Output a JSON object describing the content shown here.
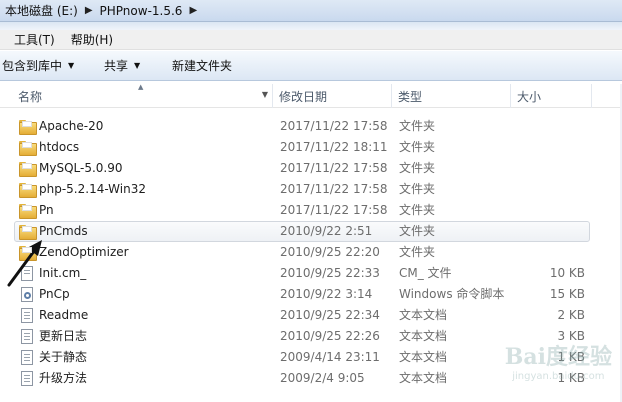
{
  "address_bar": {
    "crumbs": [
      "本地磁盘 (E:)",
      "PHPnow-1.5.6"
    ],
    "separator": "▶"
  },
  "menu": {
    "items": [
      "工具(T)",
      "帮助(H)"
    ]
  },
  "toolbar": {
    "include_library_label": "包含到库中",
    "share_label": "共享",
    "new_folder_label": "新建文件夹"
  },
  "columns": {
    "name": "名称",
    "date": "修改日期",
    "type": "类型",
    "size": "大小"
  },
  "files": [
    {
      "name": "Apache-20",
      "date": "2017/11/22 17:58",
      "type": "文件夹",
      "size": "",
      "icon": "folder-icon"
    },
    {
      "name": "htdocs",
      "date": "2017/11/22 18:11",
      "type": "文件夹",
      "size": "",
      "icon": "folder-icon"
    },
    {
      "name": "MySQL-5.0.90",
      "date": "2017/11/22 17:58",
      "type": "文件夹",
      "size": "",
      "icon": "folder-icon"
    },
    {
      "name": "php-5.2.14-Win32",
      "date": "2017/11/22 17:58",
      "type": "文件夹",
      "size": "",
      "icon": "folder-icon"
    },
    {
      "name": "Pn",
      "date": "2017/11/22 17:58",
      "type": "文件夹",
      "size": "",
      "icon": "folder-icon"
    },
    {
      "name": "PnCmds",
      "date": "2010/9/22 2:51",
      "type": "文件夹",
      "size": "",
      "icon": "folder-icon",
      "selected": true
    },
    {
      "name": "ZendOptimizer",
      "date": "2010/9/25 22:20",
      "type": "文件夹",
      "size": "",
      "icon": "folder-icon"
    },
    {
      "name": "Init.cm_",
      "date": "2010/9/25 22:33",
      "type": "CM_ 文件",
      "size": "10 KB",
      "icon": "file-icon"
    },
    {
      "name": "PnCp",
      "date": "2010/9/22 3:14",
      "type": "Windows 命令脚本",
      "size": "15 KB",
      "icon": "cmd-script-icon"
    },
    {
      "name": "Readme",
      "date": "2010/9/25 22:34",
      "type": "文本文档",
      "size": "2 KB",
      "icon": "text-document-icon"
    },
    {
      "name": "更新日志",
      "date": "2010/9/25 22:26",
      "type": "文本文档",
      "size": "3 KB",
      "icon": "text-document-icon"
    },
    {
      "name": "关于静态",
      "date": "2009/4/14 23:11",
      "type": "文本文档",
      "size": "1 KB",
      "icon": "text-document-icon"
    },
    {
      "name": "升级方法",
      "date": "2009/2/4 9:05",
      "type": "文本文档",
      "size": "1 KB",
      "icon": "text-document-icon"
    }
  ],
  "watermark": {
    "brand": "Bai度经验",
    "url": "jingyan.baidu.com"
  }
}
